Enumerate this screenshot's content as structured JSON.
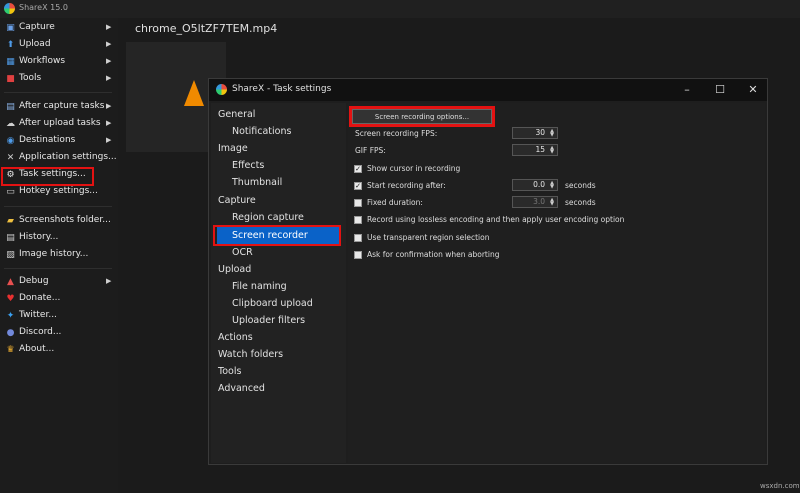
{
  "main_window": {
    "title": "ShareX 15.0"
  },
  "menu": {
    "items": [
      {
        "label": "Capture",
        "icon": "camera-icon",
        "has_submenu": true
      },
      {
        "label": "Upload",
        "icon": "upload-arrow-icon",
        "has_submenu": true
      },
      {
        "label": "Workflows",
        "icon": "workflow-icon",
        "has_submenu": true
      },
      {
        "label": "Tools",
        "icon": "toolbox-icon",
        "has_submenu": true
      },
      {
        "label": "After capture tasks",
        "icon": "after-capture-icon",
        "has_submenu": true
      },
      {
        "label": "After upload tasks",
        "icon": "after-upload-icon",
        "has_submenu": true
      },
      {
        "label": "Destinations",
        "icon": "destinations-icon",
        "has_submenu": true
      },
      {
        "label": "Application settings...",
        "icon": "wrench-icon",
        "has_submenu": false
      },
      {
        "label": "Task settings...",
        "icon": "gear-icon",
        "has_submenu": false
      },
      {
        "label": "Hotkey settings...",
        "icon": "keyboard-icon",
        "has_submenu": false
      },
      {
        "label": "Screenshots folder...",
        "icon": "folder-icon",
        "has_submenu": false
      },
      {
        "label": "History...",
        "icon": "history-icon",
        "has_submenu": false
      },
      {
        "label": "Image history...",
        "icon": "image-history-icon",
        "has_submenu": false
      },
      {
        "label": "Debug",
        "icon": "debug-icon",
        "has_submenu": true
      },
      {
        "label": "Donate...",
        "icon": "heart-icon",
        "has_submenu": false
      },
      {
        "label": "Twitter...",
        "icon": "twitter-icon",
        "has_submenu": false
      },
      {
        "label": "Discord...",
        "icon": "discord-icon",
        "has_submenu": false
      },
      {
        "label": "About...",
        "icon": "crown-icon",
        "has_submenu": false
      }
    ]
  },
  "file": {
    "name": "chrome_O5ltZF7TEM.mp4"
  },
  "task_window": {
    "title": "ShareX - Task settings",
    "nav": [
      {
        "label": "General",
        "level": 0
      },
      {
        "label": "Notifications",
        "level": 1
      },
      {
        "label": "Image",
        "level": 0
      },
      {
        "label": "Effects",
        "level": 1
      },
      {
        "label": "Thumbnail",
        "level": 1
      },
      {
        "label": "Capture",
        "level": 0
      },
      {
        "label": "Region capture",
        "level": 1
      },
      {
        "label": "Screen recorder",
        "level": 1,
        "selected": true
      },
      {
        "label": "OCR",
        "level": 1
      },
      {
        "label": "Upload",
        "level": 0
      },
      {
        "label": "File naming",
        "level": 1
      },
      {
        "label": "Clipboard upload",
        "level": 1
      },
      {
        "label": "Uploader filters",
        "level": 1
      },
      {
        "label": "Actions",
        "level": 0
      },
      {
        "label": "Watch folders",
        "level": 0
      },
      {
        "label": "Tools",
        "level": 0
      },
      {
        "label": "Advanced",
        "level": 0
      }
    ],
    "screen_recorder": {
      "options_button": "Screen recording options...",
      "fps_label": "Screen recording FPS:",
      "fps_value": "30",
      "gif_fps_label": "GIF FPS:",
      "gif_fps_value": "15",
      "show_cursor": {
        "label": "Show cursor in recording",
        "checked": true
      },
      "start_after": {
        "label": "Start recording after:",
        "checked": true,
        "value": "0.0",
        "unit": "seconds"
      },
      "fixed_duration": {
        "label": "Fixed duration:",
        "checked": false,
        "value": "3.0",
        "unit": "seconds"
      },
      "lossless": {
        "label": "Record using lossless encoding and then apply user encoding option",
        "checked": false
      },
      "transparent_region": {
        "label": "Use transparent region selection",
        "checked": false
      },
      "confirm_abort": {
        "label": "Ask for confirmation when aborting",
        "checked": false
      }
    }
  },
  "watermark": "wsxdn.com",
  "colors": {
    "highlight_red": "#e31212",
    "selection_blue": "#0a62c8"
  }
}
